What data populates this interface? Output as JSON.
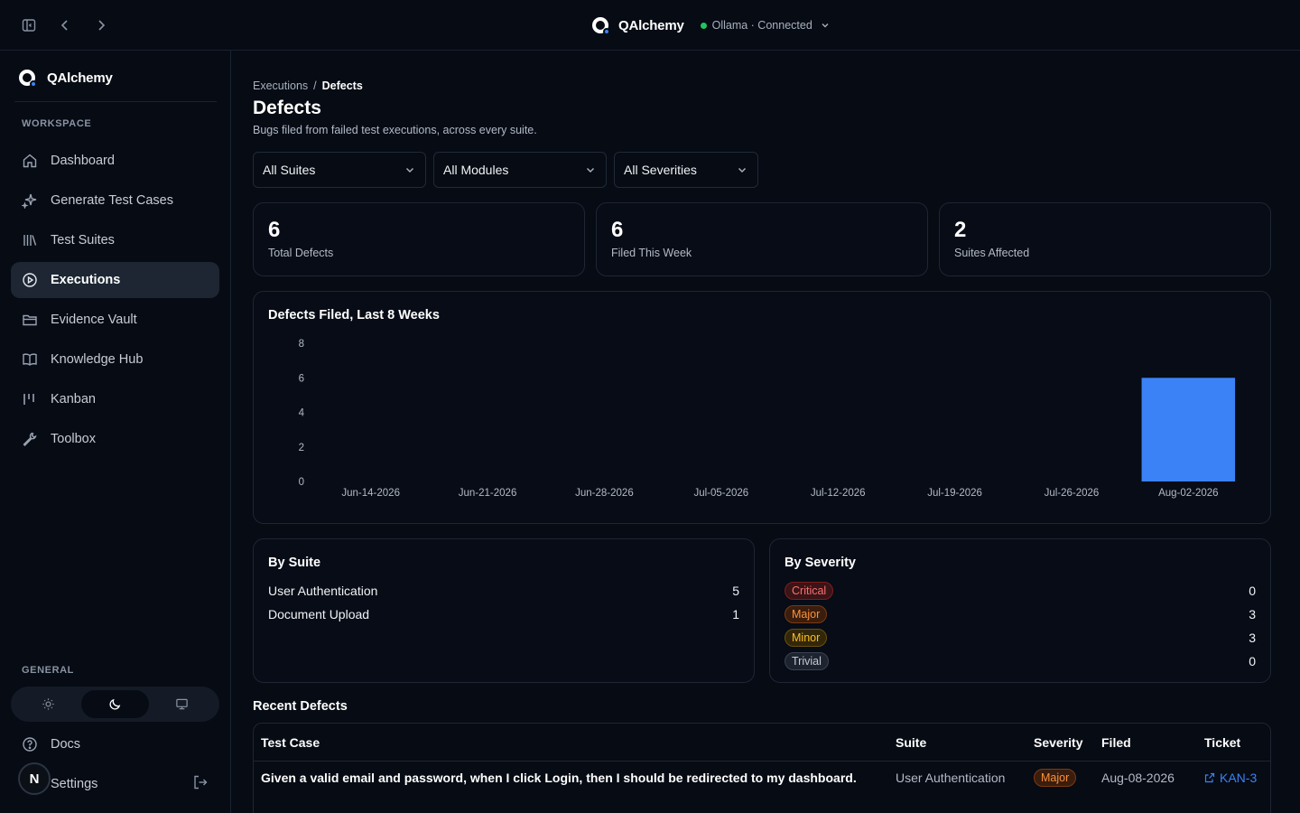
{
  "app": {
    "brand": "QAlchemy",
    "status": "Ollama · Connected"
  },
  "sidebar": {
    "brand": "QAlchemy",
    "workspace_label": "WORKSPACE",
    "general_label": "GENERAL",
    "items": [
      {
        "label": "Dashboard",
        "icon": "home-icon"
      },
      {
        "label": "Generate Test Cases",
        "icon": "sparkles-icon"
      },
      {
        "label": "Test Suites",
        "icon": "library-icon"
      },
      {
        "label": "Executions",
        "icon": "play-circle-icon",
        "active": true
      },
      {
        "label": "Evidence Vault",
        "icon": "folder-icon"
      },
      {
        "label": "Knowledge Hub",
        "icon": "book-icon"
      },
      {
        "label": "Kanban",
        "icon": "kanban-icon"
      },
      {
        "label": "Toolbox",
        "icon": "wrench-icon"
      }
    ],
    "theme_options": [
      "light",
      "dark",
      "system"
    ],
    "theme_selected": "dark",
    "docs": "Docs",
    "settings": "Settings",
    "avatar_initial": "N"
  },
  "page": {
    "breadcrumb_parent": "Executions",
    "breadcrumb_sep": "/",
    "breadcrumb_current": "Defects",
    "title": "Defects",
    "subtitle": "Bugs filed from failed test executions, across every suite."
  },
  "filters": {
    "suite": "All Suites",
    "module": "All Modules",
    "severity": "All Severities"
  },
  "stats": [
    {
      "value": "6",
      "label": "Total Defects"
    },
    {
      "value": "6",
      "label": "Filed This Week"
    },
    {
      "value": "2",
      "label": "Suites Affected"
    }
  ],
  "chart_data": {
    "type": "bar",
    "title": "Defects Filed, Last 8 Weeks",
    "categories": [
      "Jun-14-2026",
      "Jun-21-2026",
      "Jun-28-2026",
      "Jul-05-2026",
      "Jul-12-2026",
      "Jul-19-2026",
      "Jul-26-2026",
      "Aug-02-2026"
    ],
    "values": [
      0,
      0,
      0,
      0,
      0,
      0,
      0,
      6
    ],
    "ylim": [
      0,
      8
    ],
    "yticks": [
      0,
      2,
      4,
      6,
      8
    ],
    "color": "#3b82f6",
    "grid": false
  },
  "by_suite": {
    "title": "By Suite",
    "rows": [
      {
        "name": "User Authentication",
        "count": "5"
      },
      {
        "name": "Document Upload",
        "count": "1"
      }
    ]
  },
  "by_severity": {
    "title": "By Severity",
    "rows": [
      {
        "name": "Critical",
        "count": "0",
        "color": "#f87171"
      },
      {
        "name": "Major",
        "count": "3",
        "color": "#fb923c"
      },
      {
        "name": "Minor",
        "count": "3",
        "color": "#fbbf24"
      },
      {
        "name": "Trivial",
        "count": "0",
        "color": "#c5cad3"
      }
    ]
  },
  "recent": {
    "title": "Recent Defects",
    "columns": [
      "Test Case",
      "Suite",
      "Severity",
      "Filed",
      "Ticket"
    ],
    "rows": [
      {
        "test_case": "Given a valid email and password, when I click Login, then I should be redirected to my dashboard.",
        "suite": "User Authentication",
        "severity": "Major",
        "filed": "Aug-08-2026",
        "ticket": "KAN-3"
      }
    ]
  }
}
